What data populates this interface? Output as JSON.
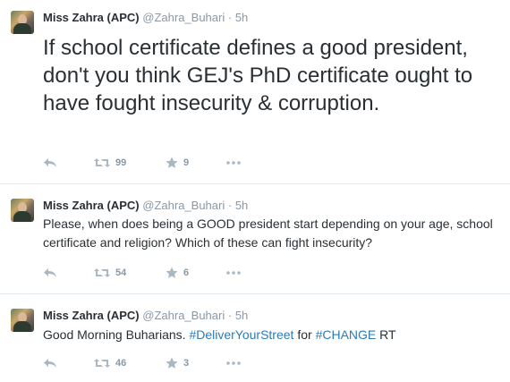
{
  "tweets": [
    {
      "name": "Miss Zahra (APC)",
      "handle": "@Zahra_Buhari",
      "dot": "·",
      "time": "5h",
      "text": "If school certificate defines a good president, don't you think GEJ's PhD certificate ought to have fought insecurity & corruption.",
      "retweets": "99",
      "favorites": "9"
    },
    {
      "name": "Miss Zahra (APC)",
      "handle": "@Zahra_Buhari",
      "dot": "·",
      "time": "5h",
      "text": "Please, when does being a GOOD president start depending on your age, school certificate and religion? Which of these can fight insecurity?",
      "retweets": "54",
      "favorites": "6"
    },
    {
      "name": "Miss Zahra (APC)",
      "handle": "@Zahra_Buhari",
      "dot": "·",
      "time": "5h",
      "text_before": "Good Morning Buharians. ",
      "hashtag1": "#DeliverYourStreet",
      "text_middle": " for ",
      "hashtag2": "#CHANGE",
      "text_after": " RT",
      "retweets": "46",
      "favorites": "3"
    }
  ],
  "icons": {
    "reply": "reply-icon",
    "retweet": "retweet-icon",
    "favorite": "favorite-star-icon",
    "more": "more-options-icon"
  },
  "colors": {
    "text": "#292f33",
    "meta": "#8899a6",
    "hashtag": "#2b7bb9",
    "divider": "#e1e8ed"
  }
}
